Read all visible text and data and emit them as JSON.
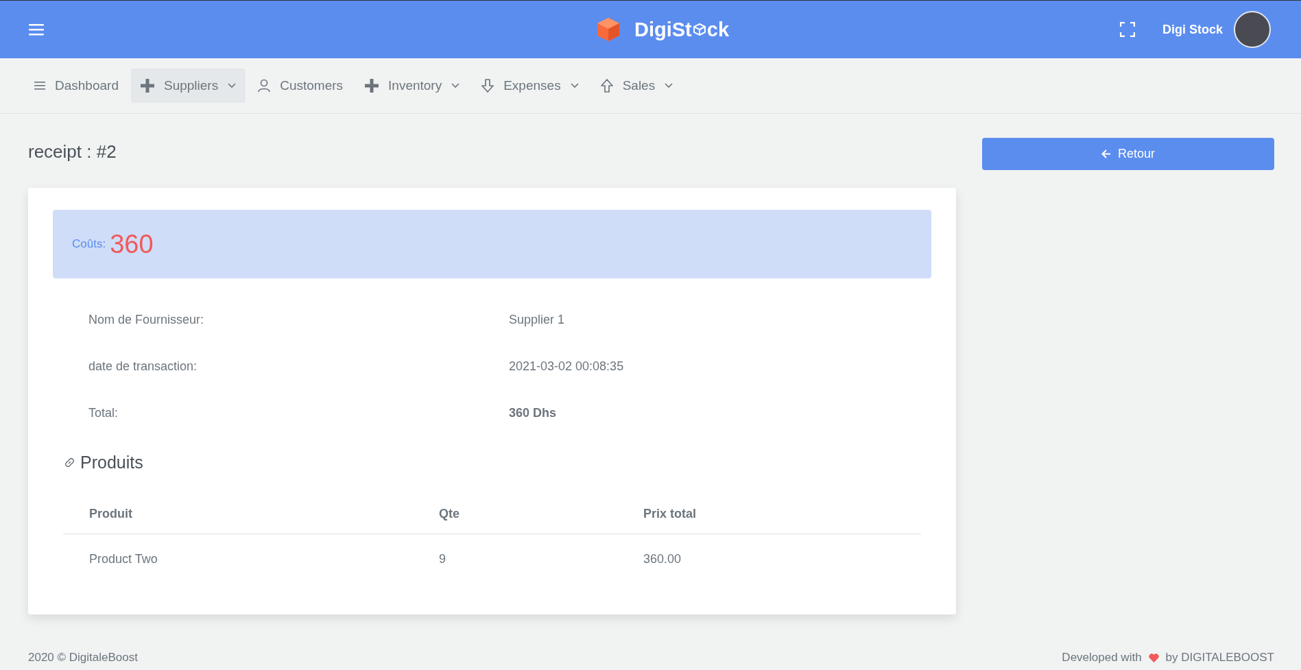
{
  "header": {
    "logo_before": "DigiSt",
    "logo_after": "ck",
    "user_name": "Digi Stock"
  },
  "nav": [
    {
      "label": "Dashboard",
      "selected": false,
      "dropdown": false
    },
    {
      "label": "Suppliers",
      "selected": true,
      "dropdown": true
    },
    {
      "label": "Customers",
      "selected": false,
      "dropdown": false
    },
    {
      "label": "Inventory",
      "selected": false,
      "dropdown": true
    },
    {
      "label": "Expenses",
      "selected": false,
      "dropdown": true
    },
    {
      "label": "Sales",
      "selected": false,
      "dropdown": true
    }
  ],
  "page_title": "receipt : #2",
  "back_button": "Retour",
  "cost": {
    "label": "Coûts:",
    "value": "360"
  },
  "details": [
    {
      "label": "Nom de Fournisseur:",
      "value": "Supplier 1",
      "strong": false
    },
    {
      "label": "date de transaction:",
      "value": "2021-03-02 00:08:35",
      "strong": false
    },
    {
      "label": "Total:",
      "value": "360 Dhs",
      "strong": true
    }
  ],
  "products_heading": "Produits",
  "table": {
    "columns": [
      "Produit",
      "Qte",
      "Prix total"
    ],
    "rows": [
      [
        "Product Two",
        "9",
        "360.00"
      ]
    ]
  },
  "footer": {
    "left": "2020 © DigitaleBoost",
    "right_before": "Developed with",
    "right_after": "by DIGITALEBOOST"
  }
}
